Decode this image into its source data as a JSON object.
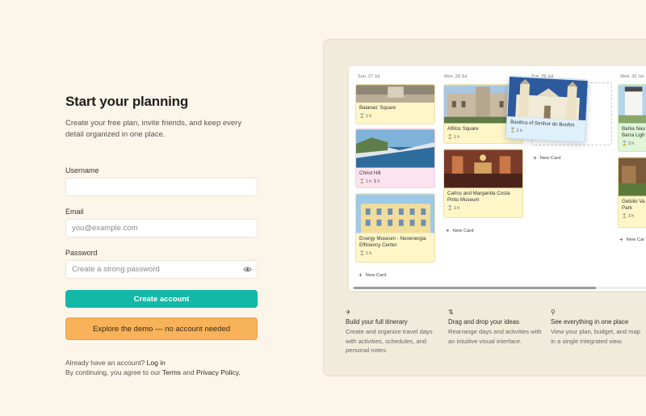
{
  "form": {
    "title": "Start your planning",
    "subtitle": "Create your free plan, invite friends, and keep every detail organized in one place.",
    "username_label": "Username",
    "username_value": "",
    "username_placeholder": "",
    "email_label": "Email",
    "email_placeholder": "you@example.com",
    "password_label": "Password",
    "password_placeholder": "Create a strong password",
    "create_button": "Create account",
    "demo_button": "Explore the demo — no account needed",
    "have_account": "Already have an account?",
    "login_link": "Log in",
    "agree_prefix": "By continuing, you agree to our",
    "terms_link": "Terms",
    "and": "and",
    "privacy_link": "Privacy Policy."
  },
  "preview": {
    "days": [
      "Sun, 27 Jul",
      "Mon, 28 Jul",
      "Tue, 29 Jul",
      "Wed, 30 Jul"
    ],
    "cards": {
      "baianas": {
        "name": "Baianas' Square",
        "time": "1 h"
      },
      "christ_hill": {
        "name": "Christ Hill",
        "time": "1 h",
        "cost": "5"
      },
      "energy": {
        "name": "Energy Museum - Neoenergia Efficiency Center",
        "time": "1 h"
      },
      "afflitos": {
        "name": "Aflitos Square",
        "time": "1 h"
      },
      "carlos": {
        "name": "Carlos and Margarida Costa Pinto Museum",
        "time": "1 h"
      },
      "basilica": {
        "name": "Basilica of Senhor do Bonfim",
        "time": "2 h"
      },
      "bahia": {
        "name": "Bahia Nau Barra Ligh",
        "time": "2 h"
      },
      "getulio": {
        "name": "Getúlio Va Park",
        "time": "2 h"
      }
    },
    "new_card": "New Card",
    "new_card_short": "New Car"
  },
  "features": [
    {
      "icon": "plane-icon",
      "title": "Build your full itinerary",
      "desc": "Create and organize travel days with activities, schedules, and personal notes."
    },
    {
      "icon": "drag-icon",
      "title": "Drag and drop your ideas",
      "desc": "Rearrange days and activities with an intuitive visual interface."
    },
    {
      "icon": "map-pin-icon",
      "title": "See everything in one place",
      "desc": "View your plan, budget, and map in a single integrated view."
    }
  ],
  "colors": {
    "page_bg": "#fcf6ea",
    "primary": "#14b8a6",
    "demo": "#f7b25a",
    "card_yellow": "#fff6c8",
    "card_pink": "#fde3f0",
    "card_blue": "#dff0fb",
    "card_green": "#e0f5d8"
  }
}
